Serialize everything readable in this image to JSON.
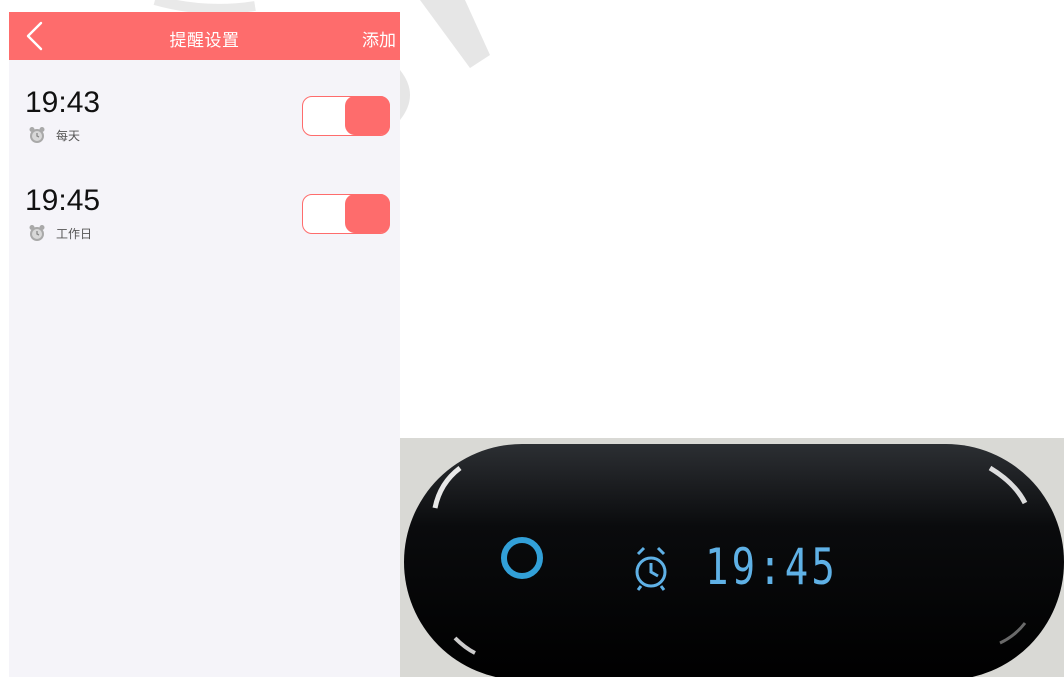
{
  "header": {
    "title": "提醒设置",
    "add_label": "添加",
    "back_icon": "chevron-left-icon"
  },
  "alarms": [
    {
      "time": "19:43",
      "repeat": "每天",
      "enabled": true,
      "icon": "alarm-clock-icon"
    },
    {
      "time": "19:45",
      "repeat": "工作日",
      "enabled": true,
      "icon": "alarm-clock-icon"
    }
  ],
  "device": {
    "display_time": "19:45",
    "alarm_icon": "alarm-clock-icon",
    "button_icon": "ring-button-icon"
  },
  "colors": {
    "accent": "#fe6c6c",
    "background": "#f5f4f9",
    "device_display": "#5fb1e6"
  }
}
